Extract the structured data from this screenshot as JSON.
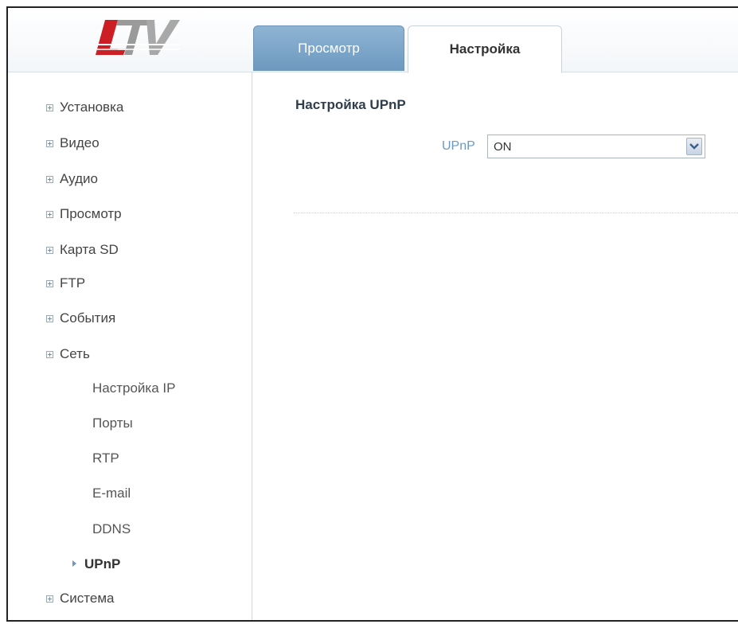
{
  "tabs": [
    {
      "label": "Просмотр"
    },
    {
      "label": "Настройка"
    }
  ],
  "sidebar": {
    "items": [
      {
        "label": "Установка"
      },
      {
        "label": "Видео"
      },
      {
        "label": "Аудио"
      },
      {
        "label": "Просмотр"
      },
      {
        "label": "Карта SD"
      },
      {
        "label": "FTP"
      },
      {
        "label": "События"
      },
      {
        "label": "Сеть"
      }
    ],
    "network_sub": [
      {
        "label": "Настройка IP"
      },
      {
        "label": "Порты"
      },
      {
        "label": "RTP"
      },
      {
        "label": "E-mail"
      },
      {
        "label": "DDNS"
      },
      {
        "label": "UPnP"
      }
    ],
    "last_item": {
      "label": "Система"
    }
  },
  "main": {
    "title": "Настройка UPnP",
    "upnp_label": "UPnP",
    "upnp_value": "ON"
  },
  "colors": {
    "accent": "#6d99c0",
    "logo_red": "#cc1f25",
    "logo_gray": "#9a9a9a"
  },
  "icons": [
    "logo",
    "expand-icon",
    "active-arrow-icon",
    "dropdown-arrow-icon"
  ]
}
